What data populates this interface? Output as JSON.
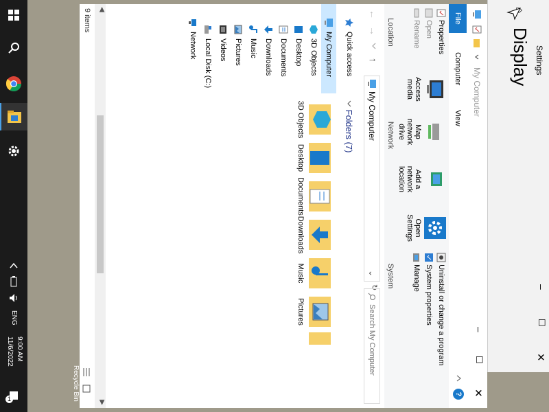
{
  "taskbar": {
    "time": "9:00 AM",
    "date": "11/6/2022",
    "language": "ENG",
    "notification_count": "1"
  },
  "settings": {
    "title": "Settings",
    "page": "Display"
  },
  "explorer": {
    "title": "My Computer",
    "tabs": [
      "File",
      "Computer",
      "View"
    ],
    "ribbon": {
      "location": {
        "label": "Location",
        "properties": "Properties",
        "open": "Open",
        "rename": "Rename"
      },
      "network": {
        "label": "Network",
        "access_media": "Access media",
        "map_network_drive": "Map network drive",
        "add_network_location": "Add a network location"
      },
      "system": {
        "label": "System",
        "open_settings": "Open Settings",
        "uninstall": "Uninstall or change a program",
        "system_properties": "System properties",
        "manage": "Manage"
      }
    },
    "address": "My Computer",
    "search_placeholder": "Search My Computer",
    "nav": [
      {
        "label": "Quick access",
        "icon": "star-icon"
      },
      {
        "label": "My Computer",
        "icon": "computer-icon"
      },
      {
        "label": "3D Objects",
        "icon": "cube-icon"
      },
      {
        "label": "Desktop",
        "icon": "desktop-icon"
      },
      {
        "label": "Documents",
        "icon": "documents-icon"
      },
      {
        "label": "Downloads",
        "icon": "downloads-icon"
      },
      {
        "label": "Music",
        "icon": "music-icon"
      },
      {
        "label": "Pictures",
        "icon": "pictures-icon"
      },
      {
        "label": "Videos",
        "icon": "videos-icon"
      },
      {
        "label": "Local Disk (C:)",
        "icon": "disk-icon"
      },
      {
        "label": "Network",
        "icon": "network-icon"
      }
    ],
    "section_header": "Folders (7)",
    "folders": [
      "3D Objects",
      "Desktop",
      "Documents",
      "Downloads",
      "Music",
      "Pictures"
    ],
    "status": "9 items"
  },
  "desktop": {
    "recycle_bin": "Recycle Bin"
  },
  "colors": {
    "accent": "#1979ca",
    "taskbar": "#1b1b1b",
    "selected": "#cce8ff"
  }
}
